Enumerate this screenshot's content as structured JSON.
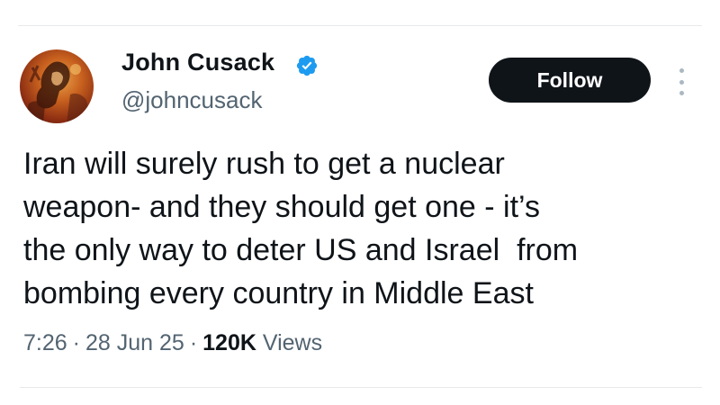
{
  "tweet": {
    "author": {
      "display_name": "John Cusack",
      "handle": "@johncusack",
      "verified": true
    },
    "follow_label": "Follow",
    "text_lines": [
      "Iran will surely rush to get a nuclear",
      "weapon- and they should get one - it’s",
      "the only way to deter US and Israel  from",
      "bombing every country in Middle East"
    ],
    "meta": {
      "time": "7:26",
      "separator": "·",
      "date": "28 Jun 25",
      "views_count": "120K",
      "views_label": "Views"
    }
  },
  "colors": {
    "text_primary": "#0f1419",
    "text_secondary": "#536471",
    "verified_badge": "#1d9bf0",
    "follow_button_bg": "#0f1419",
    "follow_button_text": "#ffffff",
    "divider": "#e7e9ea"
  },
  "icons": {
    "verified": "verified-badge-icon",
    "more": "more-options-icon"
  }
}
